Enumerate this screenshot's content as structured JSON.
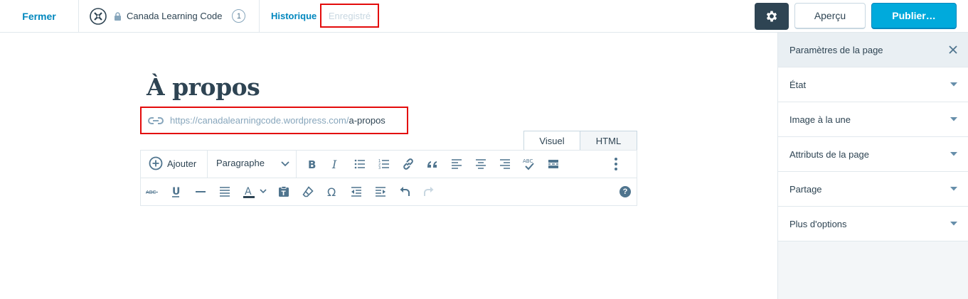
{
  "topbar": {
    "close_label": "Fermer",
    "site_name": "Canada Learning Code",
    "site_count": "1",
    "history_label": "Historique",
    "status_label": "Enregistré",
    "preview_label": "Aperçu",
    "publish_label": "Publier…",
    "icons": [
      "site-logo-icon",
      "lock-icon",
      "gear-icon"
    ]
  },
  "editor": {
    "title": "À propos",
    "permalink_base": "https://canadalearningcode.wordpress.com/",
    "permalink_slug": "a-propos",
    "tabs": [
      "Visuel",
      "HTML"
    ],
    "add_label": "Ajouter",
    "format_value": "Paragraphe",
    "help_label": "?",
    "toolbar_row1_icons": [
      "bold-icon",
      "italic-icon",
      "bullet-list-icon",
      "numbered-list-icon",
      "link-icon",
      "blockquote-icon",
      "align-left-icon",
      "align-center-icon",
      "align-right-icon",
      "spellcheck-icon",
      "read-more-icon",
      "more-options-icon"
    ],
    "toolbar_row2_icons": [
      "strikethrough-icon",
      "underline-icon",
      "horizontal-rule-icon",
      "justify-icon",
      "text-color-icon",
      "paste-text-icon",
      "clear-formatting-icon",
      "special-character-icon",
      "outdent-icon",
      "indent-icon",
      "undo-icon",
      "redo-icon",
      "help-icon"
    ]
  },
  "sidebar": {
    "title": "Paramètres de la page",
    "items": [
      {
        "label": "État"
      },
      {
        "label": "Image à la une"
      },
      {
        "label": "Attributs de la page"
      },
      {
        "label": "Partage"
      },
      {
        "label": "Plus d'options"
      }
    ]
  },
  "colors": {
    "accent": "#0087be",
    "publish": "#00aadc",
    "dark": "#2e4453",
    "highlight": "#e30b0b"
  }
}
